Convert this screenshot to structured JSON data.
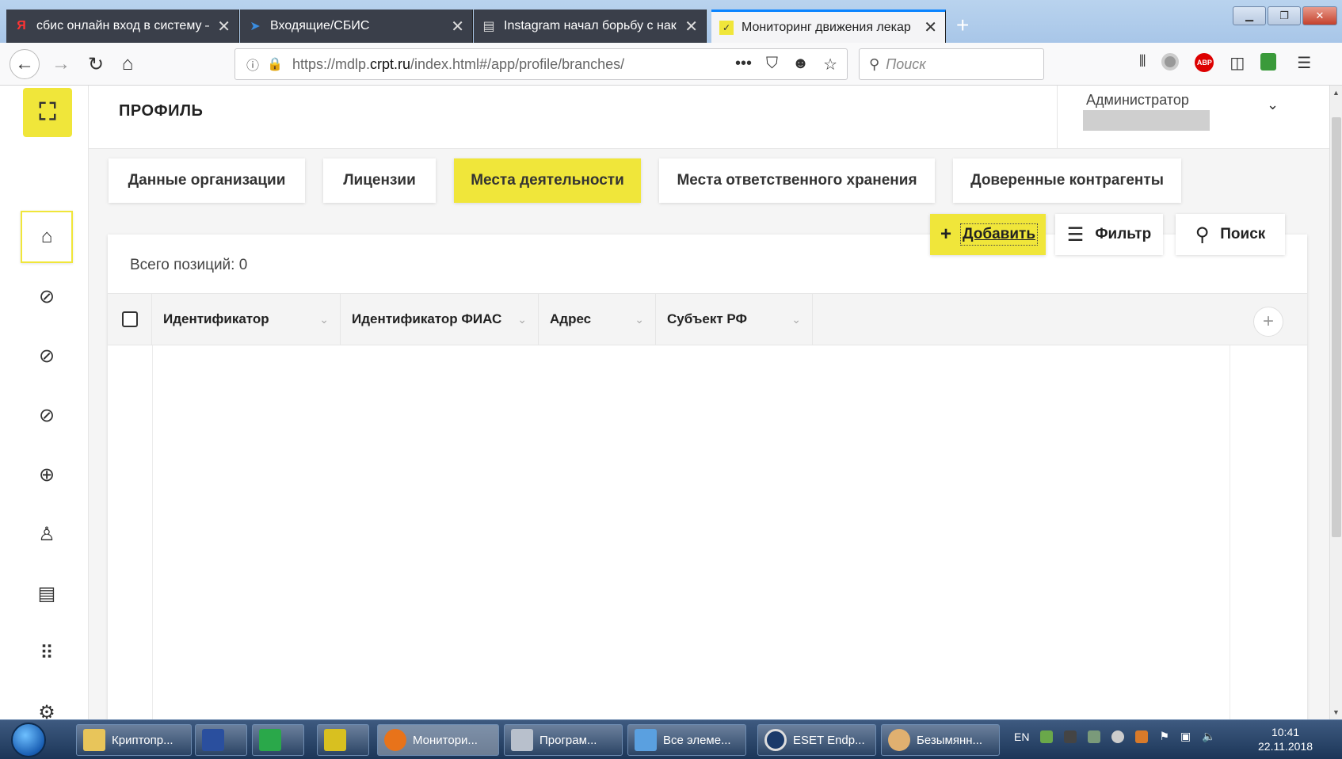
{
  "browser": {
    "tabs": [
      {
        "title": "сбис онлайн вход в систему –",
        "favicon": "Я"
      },
      {
        "title": "Входящие/СБИС",
        "favicon": "arrow-icon"
      },
      {
        "title": "Instagram начал борьбу с нак",
        "favicon": "page-icon"
      },
      {
        "title": "Мониторинг движения лекар",
        "favicon": "app-logo-icon"
      }
    ],
    "url_prefix": "https://mdlp.",
    "url_host": "crpt.ru",
    "url_path": "/index.html#/app/profile/branches/",
    "search_placeholder": "Поиск"
  },
  "app": {
    "page_title": "ПРОФИЛЬ",
    "user_role": "Администратор",
    "tabs": [
      {
        "label": "Данные организации"
      },
      {
        "label": "Лицензии"
      },
      {
        "label": "Места деятельности"
      },
      {
        "label": "Места ответственного хранения"
      },
      {
        "label": "Доверенные контрагенты"
      }
    ],
    "active_tab": "Места деятельности",
    "actions": {
      "add": "Добавить",
      "filter": "Фильтр",
      "search": "Поиск"
    },
    "total_label": "Всего позиций: 0",
    "columns": [
      "Идентификатор",
      "Идентификатор ФИАС",
      "Адрес",
      "Субъект РФ"
    ],
    "accent_color": "#f0e63a"
  },
  "taskbar": {
    "items": [
      "Криптопр...",
      "Монитори...",
      "Програм...",
      "Все элеме...",
      "ESET Endp...",
      "Безымянн..."
    ],
    "lang": "EN",
    "time": "10:41",
    "date": "22.11.2018"
  }
}
